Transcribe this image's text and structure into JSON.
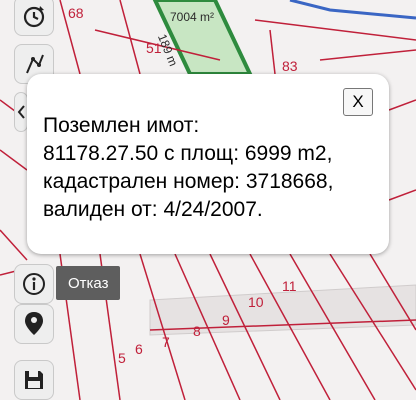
{
  "map": {
    "parcel_numbers": [
      "68",
      "51",
      "83",
      "11",
      "10",
      "9",
      "8",
      "7",
      "6",
      "5"
    ],
    "selected_parcel": {
      "area_label": "7004 m²",
      "edge_label": "189 m"
    },
    "colors": {
      "parcel_line": "#c0203a",
      "selected_parcel_border": "#2e8b3e",
      "selected_parcel_fill": "#c8e6c3",
      "background": "#f3f1f1"
    }
  },
  "toolbar": {
    "icons": [
      "history-icon",
      "measure-icon",
      "collapse-icon",
      "info-icon",
      "location-pin-icon",
      "save-icon"
    ],
    "info_tooltip": "Отказ"
  },
  "popup": {
    "close_label": "X",
    "lines": [
      "Поземлен имот:",
      "81178.27.50 с площ: 6999 m2,",
      "кадастрален номер: 3718668,",
      "валиден от: 4/24/2007."
    ]
  }
}
